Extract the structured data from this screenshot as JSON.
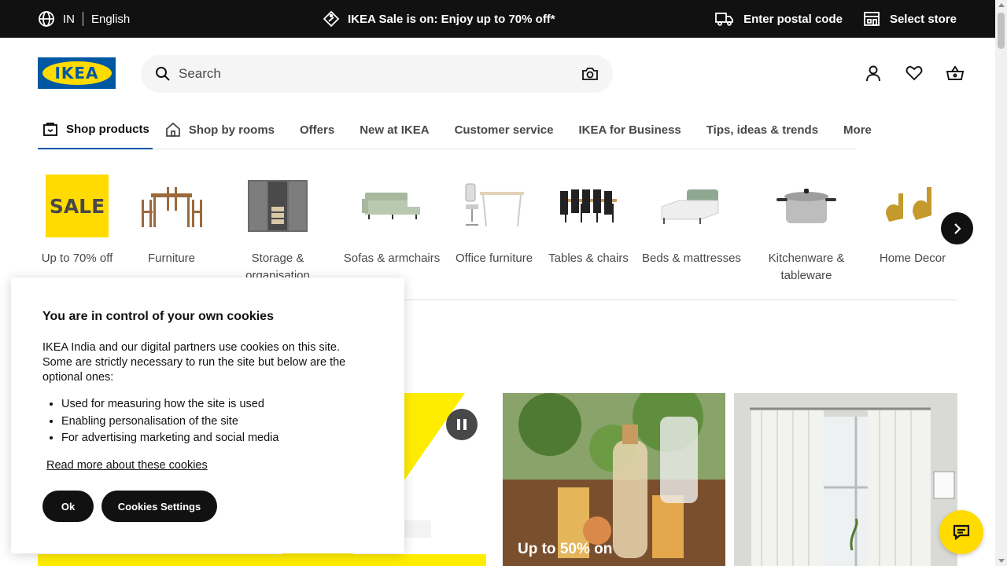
{
  "topbar": {
    "country": "IN",
    "language": "English",
    "promo": "IKEA Sale is on: Enjoy up to 70% off*",
    "postal": "Enter postal code",
    "store": "Select store"
  },
  "header": {
    "logo_text": "IKEA",
    "search_placeholder": "Search"
  },
  "nav": {
    "tabs": [
      {
        "label": "Shop products"
      },
      {
        "label": "Shop by rooms"
      },
      {
        "label": "Offers"
      },
      {
        "label": "New at IKEA"
      },
      {
        "label": "Customer service"
      },
      {
        "label": "IKEA for Business"
      },
      {
        "label": "Tips, ideas & trends"
      },
      {
        "label": "More"
      }
    ]
  },
  "categories": {
    "sale_badge": "SALE",
    "items": [
      {
        "label": "Up to 70% off"
      },
      {
        "label": "Furniture"
      },
      {
        "label": "Storage & organisation"
      },
      {
        "label": "Sofas & armchairs"
      },
      {
        "label": "Office furniture"
      },
      {
        "label": "Tables & chairs"
      },
      {
        "label": "Beds & mattresses"
      },
      {
        "label": "Kitchenware & tableware"
      },
      {
        "label": "Home Decor"
      }
    ]
  },
  "promo_cards": {
    "card1_caption": "Up to 50% on"
  },
  "cookie_banner": {
    "title": "You are in control of your own cookies",
    "description": "IKEA India and our digital partners use cookies on this site. Some are strictly necessary to run the site but below are the optional ones:",
    "bullets": [
      "Used for measuring how the site is used",
      "Enabling personalisation of the site",
      "For advertising marketing and social media"
    ],
    "read_more": "Read more about these cookies",
    "ok_label": "Ok",
    "settings_label": "Cookies Settings"
  },
  "colors": {
    "brand_blue": "#0058a3",
    "brand_yellow": "#ffdb00",
    "topbar_bg": "#111111"
  },
  "icons": [
    "globe-icon",
    "price-tag-icon",
    "truck-icon",
    "store-icon",
    "search-icon",
    "camera-icon",
    "user-icon",
    "heart-icon",
    "basket-icon",
    "shopping-bag-icon",
    "house-icon",
    "chevron-right-icon",
    "pause-icon",
    "chat-icon"
  ]
}
